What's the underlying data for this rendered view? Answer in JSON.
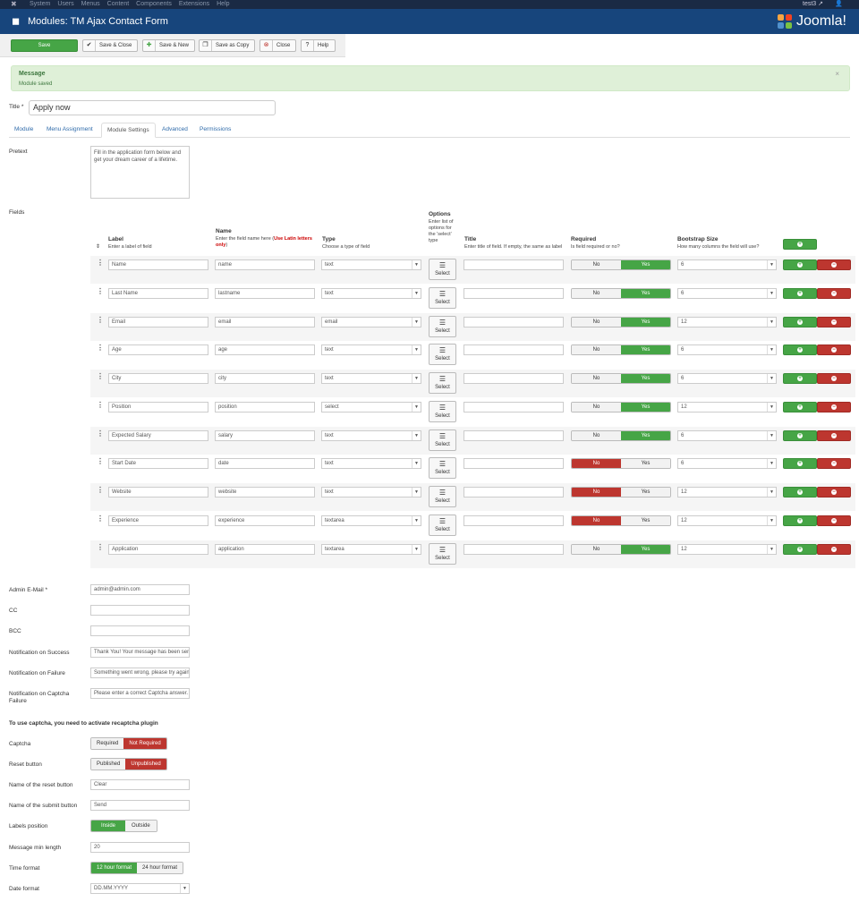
{
  "topnav": {
    "items": [
      "System",
      "Users",
      "Menus",
      "Content",
      "Components",
      "Extensions",
      "Help"
    ],
    "user": "test3 ↗"
  },
  "titlebar": {
    "title": "Modules: TM Ajax Contact Form",
    "brand": "Joomla!"
  },
  "toolbar": {
    "save": "Save",
    "save_close": "Save & Close",
    "save_new": "Save & New",
    "save_copy": "Save as Copy",
    "close": "Close",
    "help": "Help"
  },
  "message": {
    "heading": "Message",
    "text": "Module saved"
  },
  "title_field": {
    "label": "Title *",
    "value": "Apply now"
  },
  "tabs": [
    "Module",
    "Menu Assignment",
    "Module Settings",
    "Advanced",
    "Permissions"
  ],
  "pretext": {
    "label": "Pretext",
    "value": "Fill in the application form below and get your dream career of a lifetime."
  },
  "fields": {
    "label": "Fields",
    "headers": {
      "label": "Label",
      "label_desc": "Enter a label of field",
      "name": "Name",
      "name_desc": "Enter the field name here (",
      "name_warn": "Use Latin letters only",
      "name_desc_end": ")",
      "type": "Type",
      "type_desc": "Choose a type of field",
      "options": "Options",
      "options_desc": "Enter list of options for the 'select' type",
      "title": "Title",
      "title_desc": "Enter title of field. If empty, the same as label",
      "required": "Required",
      "required_desc": "Is field required or no?",
      "bootstrap": "Bootstrap Size",
      "bootstrap_desc": "How many columns the field will use?"
    },
    "select_label": "Select",
    "no_label": "No",
    "yes_label": "Yes",
    "rows": [
      {
        "label": "Name",
        "name": "name",
        "type": "text",
        "required": true,
        "size": "6"
      },
      {
        "label": "Last Name",
        "name": "lastname",
        "type": "text",
        "required": true,
        "size": "6"
      },
      {
        "label": "Email",
        "name": "email",
        "type": "email",
        "required": true,
        "size": "12"
      },
      {
        "label": "Age",
        "name": "age",
        "type": "text",
        "required": true,
        "size": "6"
      },
      {
        "label": "City",
        "name": "city",
        "type": "text",
        "required": true,
        "size": "6"
      },
      {
        "label": "Position",
        "name": "position",
        "type": "select",
        "required": true,
        "size": "12"
      },
      {
        "label": "Expected Salary",
        "name": "salary",
        "type": "text",
        "required": true,
        "size": "6"
      },
      {
        "label": "Start Date",
        "name": "date",
        "type": "text",
        "required": false,
        "size": "6"
      },
      {
        "label": "Website",
        "name": "website",
        "type": "text",
        "required": false,
        "size": "12"
      },
      {
        "label": "Experience",
        "name": "experience",
        "type": "textarea",
        "required": false,
        "size": "12"
      },
      {
        "label": "Application",
        "name": "application",
        "type": "textarea",
        "required": true,
        "size": "12"
      }
    ]
  },
  "settings": {
    "admin_email": {
      "label": "Admin E-Mail *",
      "value": "admin@admin.com"
    },
    "cc": {
      "label": "CC",
      "value": ""
    },
    "bcc": {
      "label": "BCC",
      "value": ""
    },
    "notify_success": {
      "label": "Notification on Success",
      "value": "Thank You! Your message has been sent."
    },
    "notify_failure": {
      "label": "Notification on Failure",
      "value": "Something went wrong, please try again."
    },
    "notify_captcha": {
      "label": "Notification on Captcha Failure",
      "value": "Please enter a correct Captcha answer."
    },
    "captcha_note": "To use captcha, you need to activate recaptcha plugin",
    "captcha": {
      "label": "Captcha",
      "opt1": "Required",
      "opt2": "Not Required"
    },
    "reset_button": {
      "label": "Reset button",
      "opt1": "Published",
      "opt2": "Unpublished"
    },
    "reset_name": {
      "label": "Name of the reset button",
      "value": "Clear"
    },
    "submit_name": {
      "label": "Name of the submit button",
      "value": "Send"
    },
    "labels_position": {
      "label": "Labels position",
      "opt1": "Inside",
      "opt2": "Outside"
    },
    "min_length": {
      "label": "Message min length",
      "value": "20"
    },
    "time_format": {
      "label": "Time format",
      "opt1": "12 hour format",
      "opt2": "24 hour format"
    },
    "date_format": {
      "label": "Date format",
      "value": "DD.MM.YYYY"
    }
  }
}
